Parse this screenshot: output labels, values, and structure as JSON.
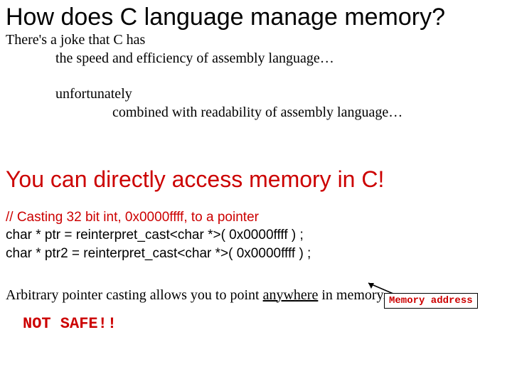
{
  "title": "How does C language manage memory?",
  "joke": {
    "l1": "There's a joke that C has",
    "l2": "the speed and efficiency of assembly language…",
    "l3": "unfortunately",
    "l4": "combined with readability of assembly language…"
  },
  "headline": "You can directly access memory in C!",
  "code": {
    "comment": "// Casting 32 bit int, 0x0000ffff, to a pointer",
    "line1": "char * ptr = reinterpret_cast<char *>( 0x0000ffff ) ;",
    "line2": "char * ptr2 = reinterpret_cast<char *>( 0x0000ffff ) ;"
  },
  "memaddr_label": "Memory address",
  "footer": {
    "pre": "Arbitrary pointer casting allows you to point ",
    "anywhere": "anywhere",
    "post": " in memory."
  },
  "notsafe": "NOT  SAFE!!"
}
